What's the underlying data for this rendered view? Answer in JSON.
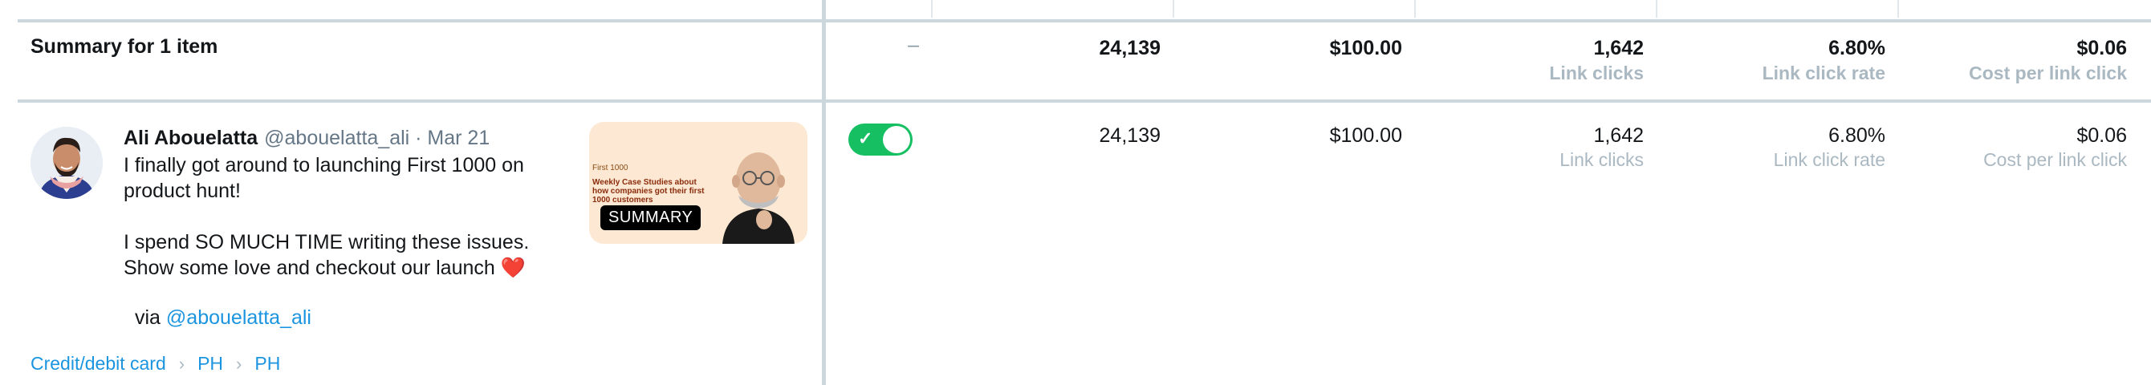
{
  "summary": {
    "label": "Summary for 1 item",
    "dash": "–",
    "impressions": "24,139",
    "spend": "$100.00",
    "link_clicks": "1,642",
    "link_clicks_label": "Link clicks",
    "link_click_rate": "6.80%",
    "link_click_rate_label": "Link click rate",
    "cost_per_link_click": "$0.06",
    "cost_per_link_click_label": "Cost per link click"
  },
  "row": {
    "tweet": {
      "author_name": "Ali Abouelatta",
      "author_meta": "@abouelatta_ali · Mar 21",
      "text_1": "I finally got around to launching First 1000 on product hunt!",
      "text_2": "I spend SO MUCH TIME writing these issues. Show some love and checkout our launch ❤️",
      "via_label": "via",
      "via_handle": "@abouelatta_ali",
      "media": {
        "small_label": "First 1000",
        "title": "Weekly Case Studies about how companies got their first 1000 customers",
        "badge": "SUMMARY"
      }
    },
    "breadcrumb": [
      "Credit/debit card",
      "PH",
      "PH"
    ],
    "toggle_on": true,
    "impressions": "24,139",
    "spend": "$100.00",
    "link_clicks": "1,642",
    "link_clicks_label": "Link clicks",
    "link_click_rate": "6.80%",
    "link_click_rate_label": "Link click rate",
    "cost_per_link_click": "$0.06",
    "cost_per_link_click_label": "Cost per link click"
  },
  "colors": {
    "accent_link": "#1b95e0",
    "toggle_on": "#17bf63",
    "divider": "#ccd6dd",
    "muted_text": "#aab8c2"
  }
}
